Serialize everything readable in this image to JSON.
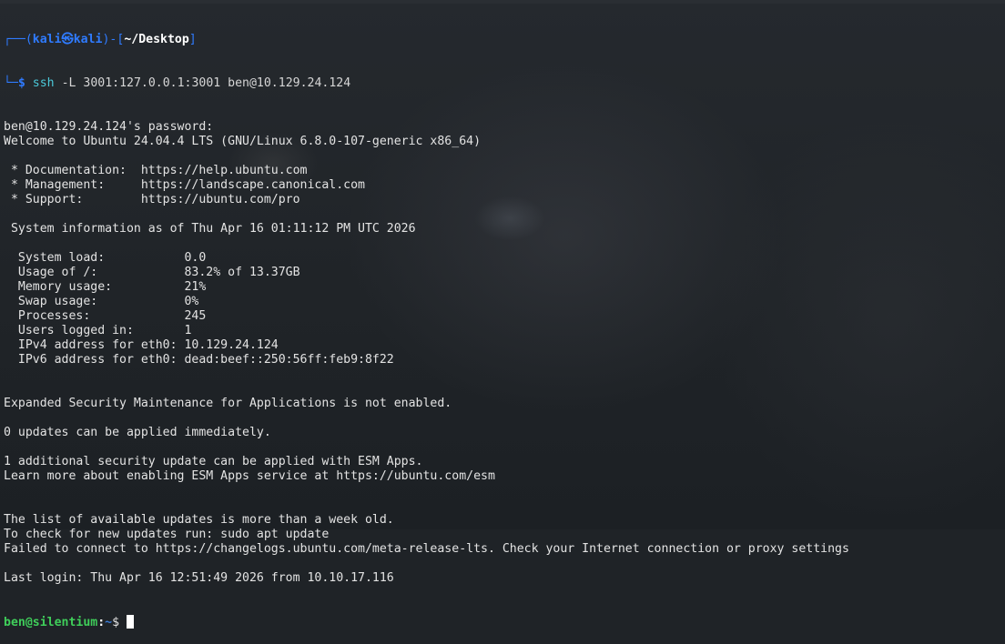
{
  "prompt1": {
    "corner_top": "┌──(",
    "user": "kali",
    "at_symbol": "㉿",
    "host": "kali",
    "mid": ")-[",
    "path": "~/Desktop",
    "close": "]",
    "corner_bottom": "└─",
    "dollar": "$",
    "command": "ssh",
    "args": " -L 3001:127.0.0.1:3001 ben@10.129.24.124"
  },
  "lines": [
    "ben@10.129.24.124's password: ",
    "Welcome to Ubuntu 24.04.4 LTS (GNU/Linux 6.8.0-107-generic x86_64)",
    "",
    " * Documentation:  https://help.ubuntu.com",
    " * Management:     https://landscape.canonical.com",
    " * Support:        https://ubuntu.com/pro",
    "",
    " System information as of Thu Apr 16 01:11:12 PM UTC 2026",
    "",
    "  System load:           0.0",
    "  Usage of /:            83.2% of 13.37GB",
    "  Memory usage:          21%",
    "  Swap usage:            0%",
    "  Processes:             245",
    "  Users logged in:       1",
    "  IPv4 address for eth0: 10.129.24.124",
    "  IPv6 address for eth0: dead:beef::250:56ff:feb9:8f22",
    "",
    "",
    "Expanded Security Maintenance for Applications is not enabled.",
    "",
    "0 updates can be applied immediately.",
    "",
    "1 additional security update can be applied with ESM Apps.",
    "Learn more about enabling ESM Apps service at https://ubuntu.com/esm",
    "",
    "",
    "The list of available updates is more than a week old.",
    "To check for new updates run: sudo apt update",
    "Failed to connect to https://changelogs.ubuntu.com/meta-release-lts. Check your Internet connection or proxy settings",
    "",
    "Last login: Thu Apr 16 12:51:49 2026 from 10.10.17.116"
  ],
  "prompt2": {
    "user_host": "ben@silentium",
    "colon": ":",
    "path": "~",
    "dollar": "$ "
  },
  "colors": {
    "background": "#1f2327",
    "text": "#e3e3e3",
    "kali_prompt": "#2f7bff",
    "remote_user": "#3fce5a",
    "remote_path": "#3a7bd5"
  }
}
